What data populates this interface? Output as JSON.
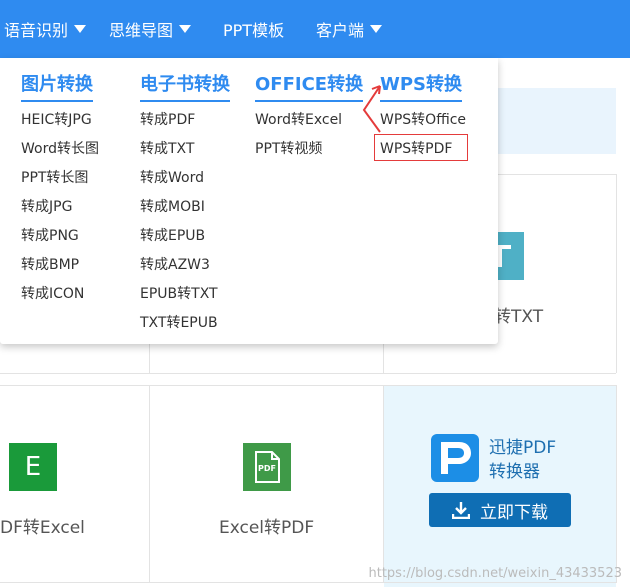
{
  "nav": {
    "items": [
      {
        "label": "语音识别",
        "has_caret": true
      },
      {
        "label": "思维导图",
        "has_caret": true
      },
      {
        "label": "PPT模板",
        "has_caret": false
      },
      {
        "label": "客户端",
        "has_caret": true
      }
    ]
  },
  "dropdown": {
    "columns": [
      {
        "heading": "图片转换",
        "items": [
          "HEIC转JPG",
          "Word转长图",
          "PPT转长图",
          "转成JPG",
          "转成PNG",
          "转成BMP",
          "转成ICON"
        ]
      },
      {
        "heading": "电子书转换",
        "items": [
          "转成PDF",
          "转成TXT",
          "转成Word",
          "转成MOBI",
          "转成EPUB",
          "转成AZW3",
          "EPUB转TXT",
          "TXT转EPUB"
        ]
      },
      {
        "heading": "OFFICE转换",
        "items": [
          "Word转Excel",
          "PPT转视频"
        ]
      },
      {
        "heading": "WPS转换",
        "items": [
          "WPS转Office",
          "WPS转PDF"
        ]
      }
    ]
  },
  "cards": {
    "partial_txt_label": "转TXT",
    "pdf_to_excel_label": "DF转Excel",
    "excel_to_pdf_label": "Excel转PDF",
    "excel_icon_letter": "E",
    "pdf_icon_text": "PDF"
  },
  "promo": {
    "title_line1": "迅捷PDF",
    "title_line2": "转换器",
    "download_label": "立即下载"
  },
  "watermark": "https://blog.csdn.net/weixin_43433523",
  "colors": {
    "nav_bg": "#2f8bf0",
    "accent": "#2f8bf0",
    "excel_green": "#1a9a3a",
    "pdf_green": "#3f9a48",
    "txt_teal": "#4fb0c6",
    "download_btn": "#0f6eb4",
    "highlight_red": "#e43b3b"
  }
}
